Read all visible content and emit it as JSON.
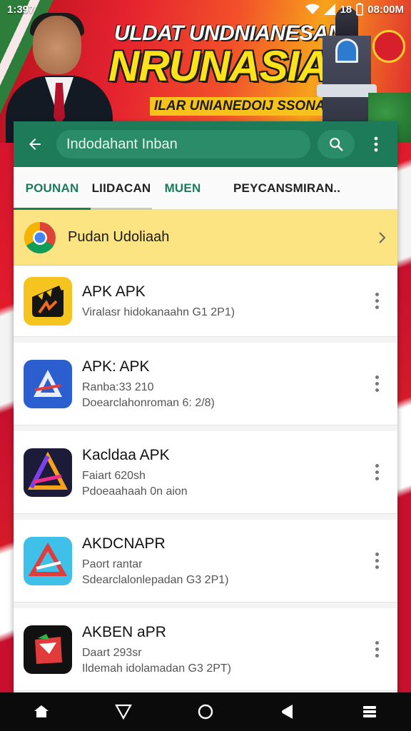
{
  "status_bar": {
    "time": "1:397",
    "right_text": "08:00M",
    "sim_text": "18"
  },
  "banner": {
    "title_line1": "ULDAT UNDNIANESAN",
    "title_line2": "NRUNASIA!",
    "subtitle": "ILAR UNIANEDOIJ SSONA ?"
  },
  "app_bar": {
    "search_value": "Indodahant Inban",
    "icons": {
      "back": "arrow-back-icon",
      "search": "search-icon",
      "more": "more-vert-icon"
    }
  },
  "tabs": [
    {
      "label": "POUNAN",
      "active": true
    },
    {
      "label": "LIIDACAN"
    },
    {
      "label": "MUEN"
    },
    {
      "label": "PEYCANSMIRAN.."
    }
  ],
  "promo": {
    "label": "Pudan Udoliaah",
    "icon": "chrome-icon"
  },
  "apps": [
    {
      "name": "APK APK",
      "lines": [
        "Viralasr hidokanaahn G1 2P1)"
      ],
      "icon": "clapper-icon",
      "icon_bg": "#f5c41e"
    },
    {
      "name": "APK: APK",
      "lines": [
        "Ranba:33 210",
        "Doearclahonroman 6: 2/8)"
      ],
      "icon": "triangle-arrow-icon",
      "icon_bg": "#2b5fcf"
    },
    {
      "name": "Kacldaa APK",
      "lines": [
        "Faiart 620sh",
        "Pdoeaahaah 0n aion"
      ],
      "icon": "neon-triangle-icon",
      "icon_bg": "#1c1c3a"
    },
    {
      "name": "AKDCNAPR",
      "lines": [
        "Paort rantar",
        "Sdearclalonlepadan G3 2P1)"
      ],
      "icon": "red-triangle-icon",
      "icon_bg": "#3ec0e8"
    },
    {
      "name": "AKBEN aPR",
      "lines": [
        "Daart 293sr",
        "Ildemah idolamadan G3 2PT)"
      ],
      "icon": "red-box-icon",
      "icon_bg": "#111111"
    }
  ],
  "nav": {
    "icons": [
      "home-icon",
      "back-triangle-icon",
      "circle-home-icon",
      "recents-icon",
      "menu-icon"
    ]
  },
  "colors": {
    "primary": "#1d7b5a",
    "promo_bg": "#fbe481",
    "banner_yellow": "#ffe21a"
  }
}
